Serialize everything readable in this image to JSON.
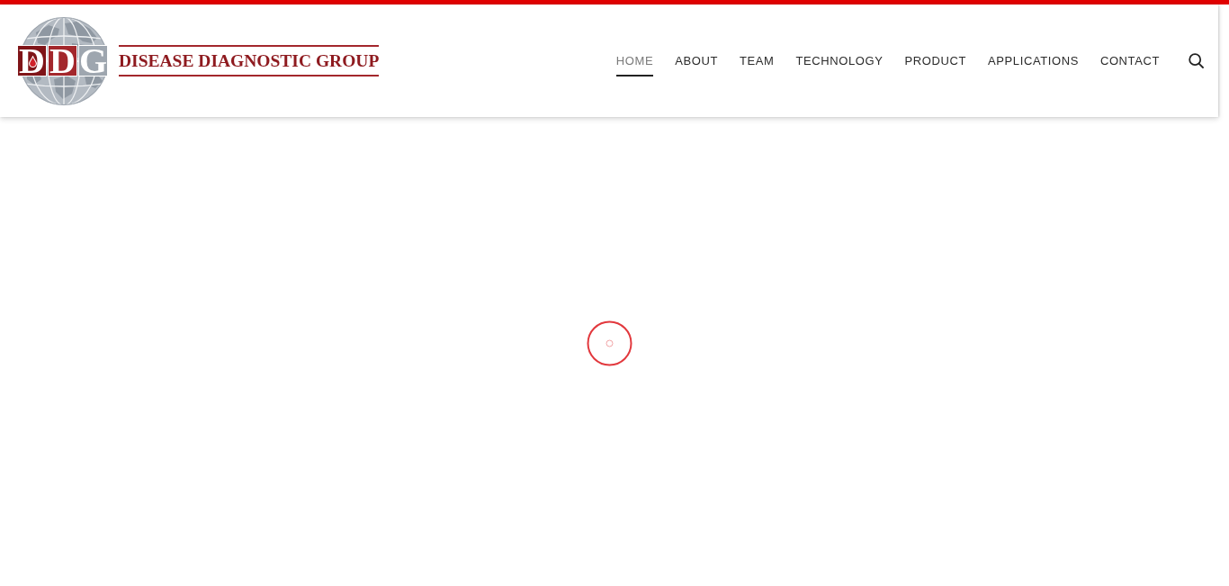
{
  "logo": {
    "monogram": [
      {
        "letter": "D",
        "color": "#7f1418",
        "drop": true
      },
      {
        "letter": "D",
        "color": "#a3272c",
        "drop": false
      },
      {
        "letter": "G",
        "color": "#9ea6af",
        "drop": false
      }
    ],
    "name": "DISEASE DIAGNOSTIC GROUP"
  },
  "nav": {
    "items": [
      {
        "label": "HOME",
        "selected": true
      },
      {
        "label": "ABOUT",
        "selected": false
      },
      {
        "label": "TEAM",
        "selected": false
      },
      {
        "label": "TECHNOLOGY",
        "selected": false
      },
      {
        "label": "PRODUCT",
        "selected": false
      },
      {
        "label": "APPLICATIONS",
        "selected": false
      },
      {
        "label": "CONTACT",
        "selected": false
      }
    ]
  }
}
